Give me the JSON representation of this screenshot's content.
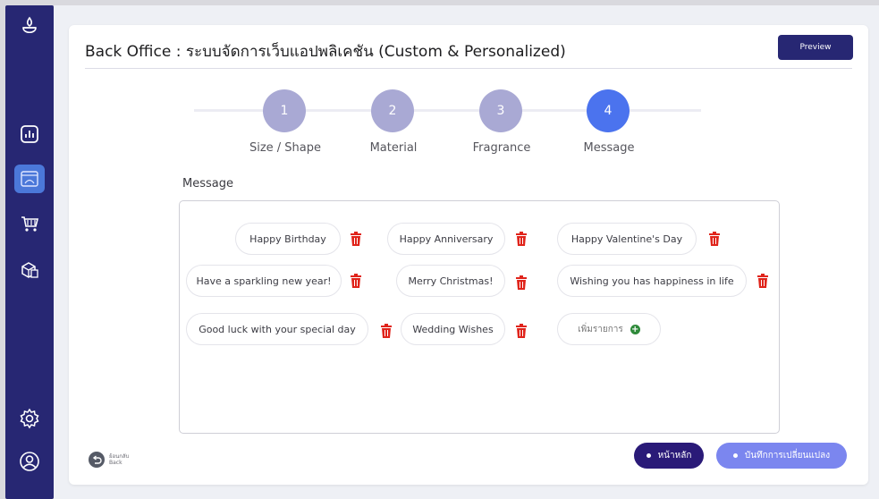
{
  "sidebar": {
    "items": [
      {
        "icon": "candle-logo-icon"
      },
      {
        "icon": "bar-chart-icon"
      },
      {
        "icon": "web-app-icon",
        "active": true
      },
      {
        "icon": "shopping-cart-icon"
      },
      {
        "icon": "boxes-icon"
      },
      {
        "icon": "gear-icon"
      },
      {
        "icon": "user-circle-icon"
      }
    ],
    "colors": {
      "bg": "#272773",
      "active": "#4b78d9"
    }
  },
  "header": {
    "title": "Back Office : ระบบจัดการเว็บแอปพลิเคชัน (Custom & Personalized)",
    "preview_label": "Preview"
  },
  "stepper": {
    "steps": [
      {
        "number": "1",
        "label": "Size / Shape",
        "state": "done"
      },
      {
        "number": "2",
        "label": "Material",
        "state": "done"
      },
      {
        "number": "3",
        "label": "Fragrance",
        "state": "done"
      },
      {
        "number": "4",
        "label": "Message",
        "state": "active"
      }
    ]
  },
  "section": {
    "label": "Message"
  },
  "messages": [
    "Happy Birthday",
    "Happy Anniversary",
    "Happy Valentine's Day",
    "Have a sparkling new year!",
    "Merry Christmas!",
    "Wishing you has happiness in life",
    "Good luck with your special day",
    "Wedding Wishes"
  ],
  "add_item_label": "เพิ่มรายการ",
  "footer": {
    "back_label_th": "ย้อนกลับ",
    "back_label_en": "Back",
    "home_label": "หน้าหลัก",
    "save_label": "บันทึกการเปลี่ยนแปลง"
  },
  "colors": {
    "primary": "#272773",
    "accent": "#4b73ee",
    "step_done": "#a9a9d4",
    "trash": "#e0241b",
    "add": "#2e8a3a"
  }
}
